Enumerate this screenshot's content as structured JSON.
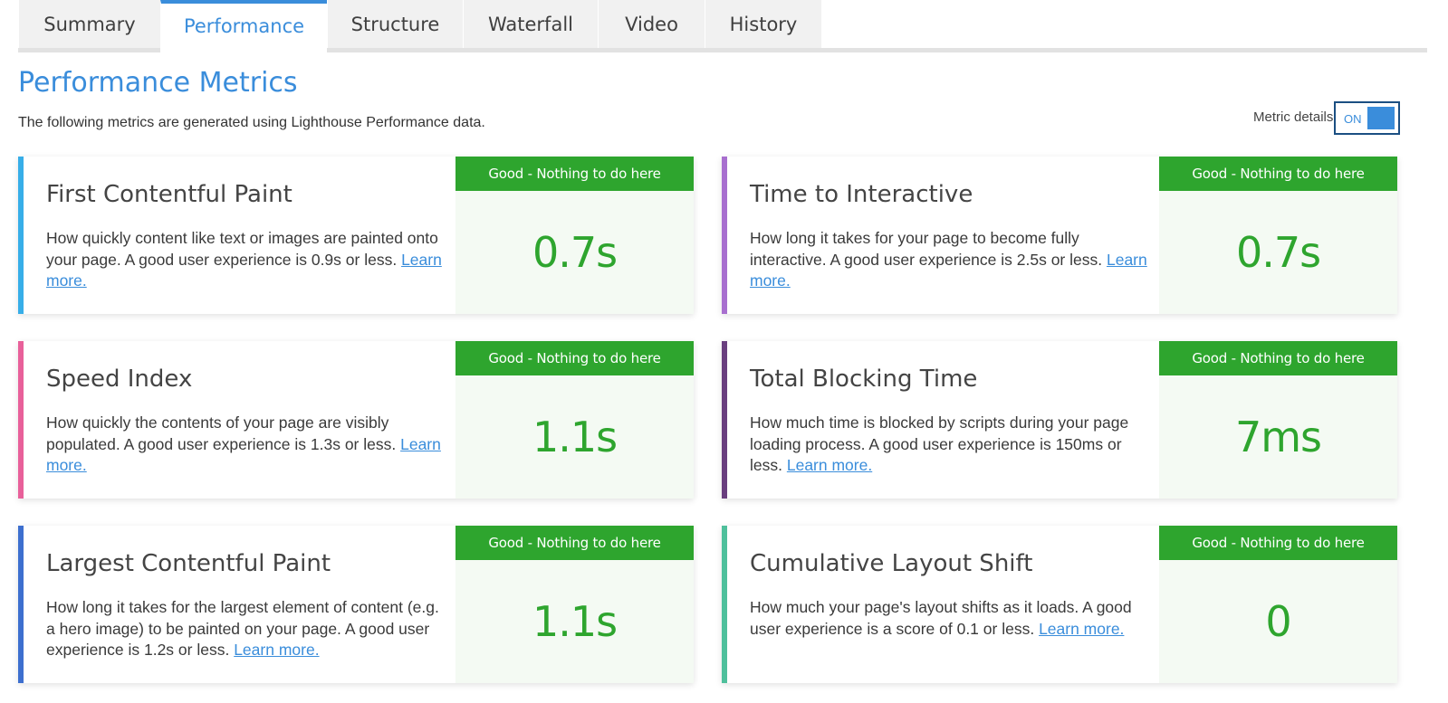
{
  "tabs": [
    {
      "label": "Summary",
      "active": false
    },
    {
      "label": "Performance",
      "active": true
    },
    {
      "label": "Structure",
      "active": false
    },
    {
      "label": "Waterfall",
      "active": false
    },
    {
      "label": "Video",
      "active": false
    },
    {
      "label": "History",
      "active": false
    }
  ],
  "header": {
    "title": "Performance Metrics",
    "intro": "The following metrics are generated using Lighthouse Performance data."
  },
  "metric_details_toggle": {
    "label": "Metric details",
    "state": "ON"
  },
  "colors": {
    "brand_blue": "#3a8ddb",
    "status_good": "#2ea52e",
    "score_panel_bg": "#f4faf3"
  },
  "metrics": [
    {
      "title": "First Contentful Paint",
      "description": "How quickly content like text or images are painted onto your page. A good user experience is 0.9s or less.",
      "learn_more": "Learn more.",
      "status": "Good - Nothing to do here",
      "value": "0.7s",
      "accent_color": "#37aee8"
    },
    {
      "title": "Time to Interactive",
      "description": "How long it takes for your page to become fully interactive. A good user experience is 2.5s or less.",
      "learn_more": "Learn more.",
      "status": "Good - Nothing to do here",
      "value": "0.7s",
      "accent_color": "#a86fcf"
    },
    {
      "title": "Speed Index",
      "description": "How quickly the contents of your page are visibly populated. A good user experience is 1.3s or less.",
      "learn_more": "Learn more.",
      "status": "Good - Nothing to do here",
      "value": "1.1s",
      "accent_color": "#e8609a"
    },
    {
      "title": "Total Blocking Time",
      "description": "How much time is blocked by scripts during your page loading process. A good user experience is 150ms or less.",
      "learn_more": "Learn more.",
      "status": "Good - Nothing to do here",
      "value": "7ms",
      "accent_color": "#6a3f7f"
    },
    {
      "title": "Largest Contentful Paint",
      "description": "How long it takes for the largest element of content (e.g. a hero image) to be painted on your page. A good user experience is 1.2s or less.",
      "learn_more": "Learn more.",
      "status": "Good - Nothing to do here",
      "value": "1.1s",
      "accent_color": "#3d6fcf"
    },
    {
      "title": "Cumulative Layout Shift",
      "description": "How much your page's layout shifts as it loads. A good user experience is a score of 0.1 or less.",
      "learn_more": "Learn more.",
      "status": "Good - Nothing to do here",
      "value": "0",
      "accent_color": "#4fc09c"
    }
  ]
}
